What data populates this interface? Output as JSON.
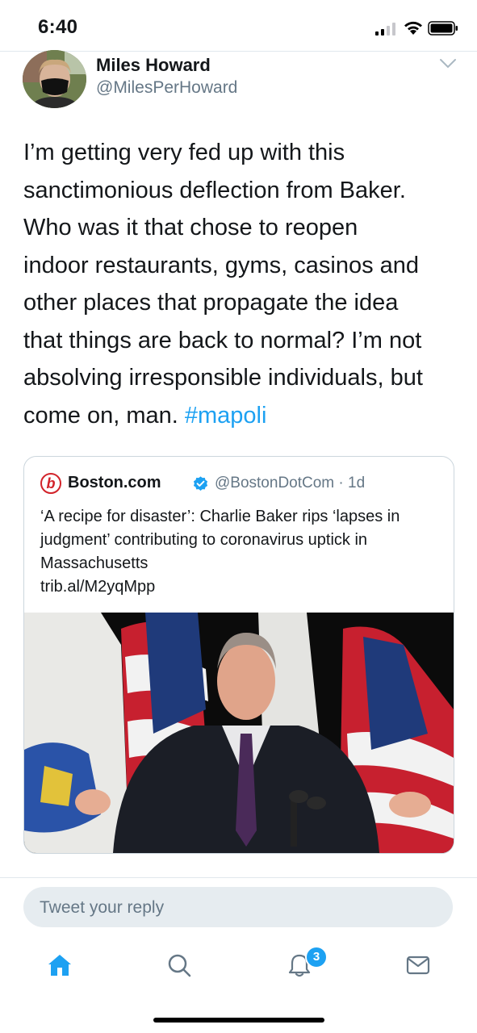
{
  "status_bar": {
    "time": "6:40"
  },
  "tweet": {
    "author_name": "Miles Howard",
    "author_handle": "@MilesPerHoward",
    "text_lines": [
      "I’m getting very fed up with this",
      "sanctimonious deflection from Baker.",
      "Who was it that chose to reopen",
      "indoor restaurants, gyms, casinos and",
      "other places that propagate the idea",
      "that things are back to normal? I’m not",
      "absolving irresponsible individuals, but"
    ],
    "text_last_prefix": "come on, man.",
    "hashtag": "#mapoli"
  },
  "quoted": {
    "logo_letter": "b",
    "name": "Boston.com",
    "handle_time": "@BostonDotCom · 1d",
    "headline": "‘A recipe for disaster’: Charlie Baker rips ‘lapses in judgment’ contributing to coronavirus uptick in Massachusetts",
    "link": "trib.al/M2yqMpp",
    "colors": {
      "logo": "#d2232a",
      "verified": "#1da1f2"
    }
  },
  "reply": {
    "placeholder": "Tweet your reply"
  },
  "tab_bar": {
    "items": [
      {
        "icon": "home-icon"
      },
      {
        "icon": "search-icon"
      },
      {
        "icon": "notifications-icon"
      },
      {
        "icon": "messages-icon"
      }
    ],
    "notification_count": "3"
  },
  "colors": {
    "accent": "#1da1f2",
    "secondary_text": "#657786",
    "reply_bg": "#e6ecf0"
  }
}
